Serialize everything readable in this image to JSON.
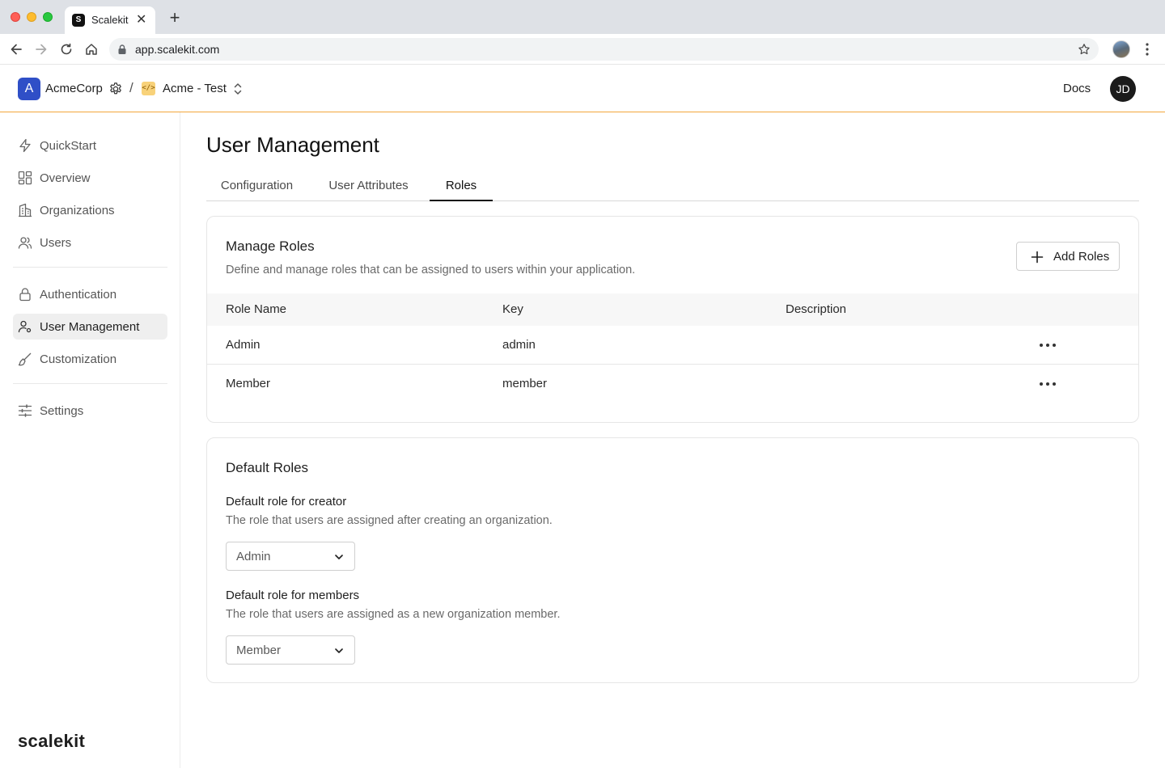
{
  "browser": {
    "tab_title": "Scalekit",
    "favicon_letter": "S",
    "url": "app.scalekit.com"
  },
  "header": {
    "org_initial": "A",
    "org_name": "AcmeCorp",
    "separator": "/",
    "env_icon": "</>",
    "env_name": "Acme - Test",
    "docs_label": "Docs",
    "user_initials": "JD",
    "accent_color": "#f2a73b"
  },
  "sidebar": {
    "items": [
      {
        "label": "QuickStart",
        "icon": "lightning-icon"
      },
      {
        "label": "Overview",
        "icon": "dashboard-icon"
      },
      {
        "label": "Organizations",
        "icon": "building-icon"
      },
      {
        "label": "Users",
        "icon": "users-icon"
      },
      {
        "label": "Authentication",
        "icon": "lock-icon"
      },
      {
        "label": "User Management",
        "icon": "user-cog-icon",
        "active": true
      },
      {
        "label": "Customization",
        "icon": "brush-icon"
      },
      {
        "label": "Settings",
        "icon": "sliders-icon"
      }
    ],
    "brand": "scalekit"
  },
  "main": {
    "title": "User Management",
    "tabs": [
      {
        "label": "Configuration"
      },
      {
        "label": "User Attributes"
      },
      {
        "label": "Roles",
        "active": true
      }
    ],
    "manage_roles": {
      "title": "Manage Roles",
      "description": "Define and manage roles that can be assigned to users within your application.",
      "add_button": "Add Roles",
      "columns": [
        "Role Name",
        "Key",
        "Description"
      ],
      "rows": [
        {
          "name": "Admin",
          "key": "admin",
          "description": ""
        },
        {
          "name": "Member",
          "key": "member",
          "description": ""
        }
      ]
    },
    "default_roles": {
      "title": "Default Roles",
      "creator": {
        "label": "Default role for creator",
        "help": "The role that users are assigned after creating an organization.",
        "value": "Admin"
      },
      "members": {
        "label": "Default role for members",
        "help": "The role that users are assigned as a new organization member.",
        "value": "Member"
      }
    }
  }
}
